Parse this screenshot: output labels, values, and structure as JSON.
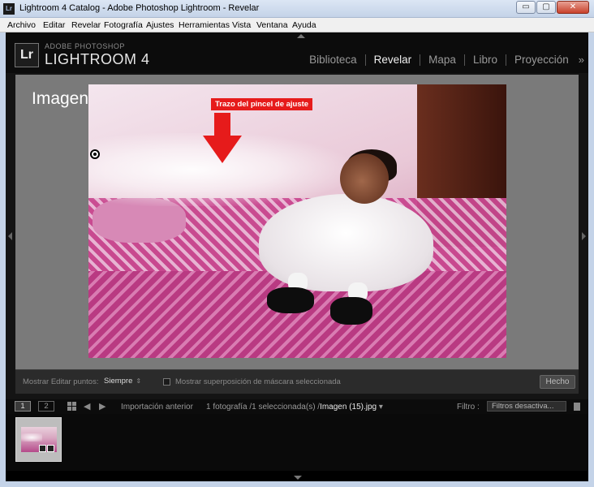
{
  "window": {
    "title": "Lightroom 4 Catalog - Adobe Photoshop Lightroom - Revelar",
    "app_icon": "Lr",
    "controls": {
      "minimize": "▭",
      "maximize": "▢",
      "close": "✕"
    }
  },
  "menubar": [
    "Archivo",
    "Editar",
    "Revelar",
    "Fotografía",
    "Ajustes",
    "Herramientas",
    "Vista",
    "Ventana",
    "Ayuda"
  ],
  "identity": {
    "logo": "Lr",
    "brand_small": "ADOBE PHOTOSHOP",
    "brand_main": "LIGHTROOM 4"
  },
  "modules": [
    {
      "label": "Biblioteca",
      "active": false
    },
    {
      "label": "Revelar",
      "active": true
    },
    {
      "label": "Mapa",
      "active": false
    },
    {
      "label": "Libro",
      "active": false
    },
    {
      "label": "Proyección",
      "active": false
    }
  ],
  "modules_more": "»",
  "photo": {
    "name": "Imagen (15).jpg",
    "annotation": "Trazo del pincel de ajuste"
  },
  "toolbar": {
    "show_edit_points_label": "Mostrar Editar puntos:",
    "show_edit_points_value": "Siempre",
    "mask_overlay_label": "Mostrar superposición de máscara seleccionada",
    "done_button": "Hecho"
  },
  "filmstrip": {
    "view1": "1",
    "view2": "2",
    "prev": "◀",
    "next": "▶",
    "source": "Importación anterior",
    "breadcrumb_prefix": "1 fotografía /1 seleccionada(s) /",
    "breadcrumb_file": "Imagen (15).jpg",
    "filter_label": "Filtro :",
    "filter_value": "Filtros desactiva..."
  },
  "colors": {
    "annotation_red": "#e61b1b",
    "background": "#000000",
    "view_gray": "#7a7a7a"
  }
}
